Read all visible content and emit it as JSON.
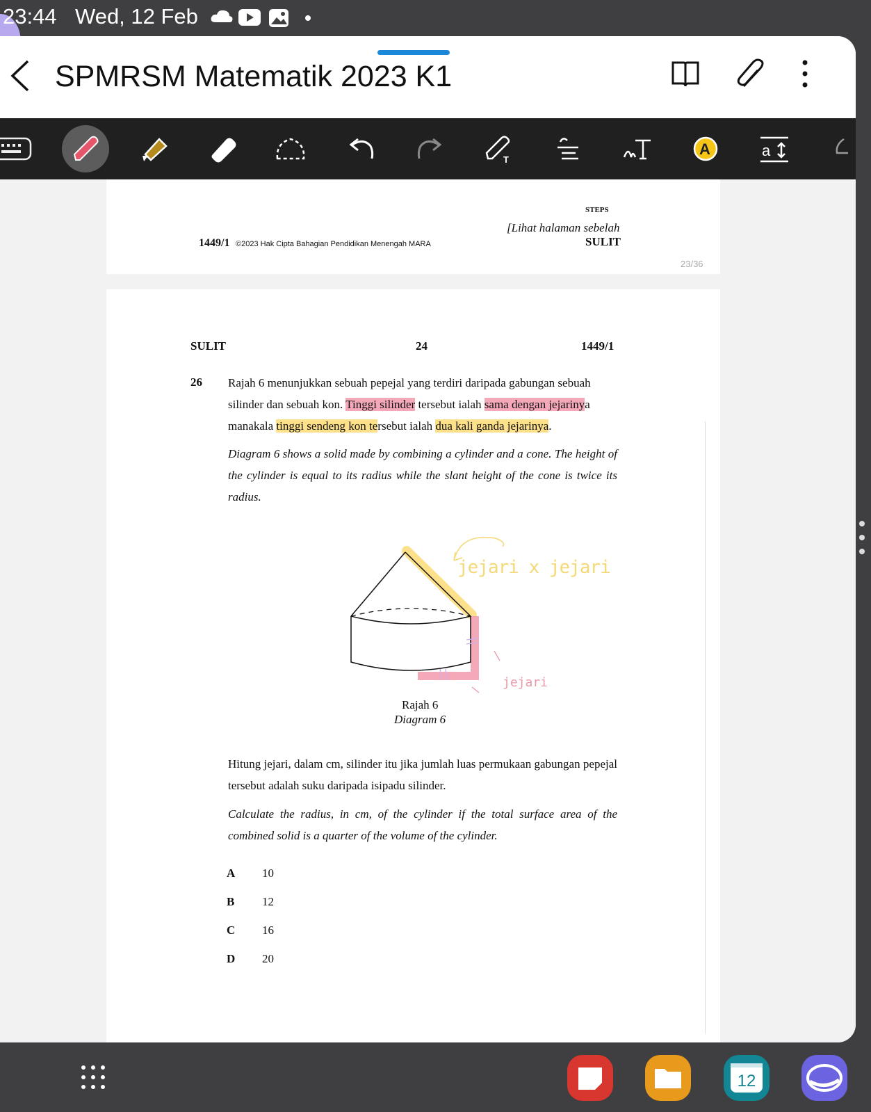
{
  "status_bar": {
    "time": "23:44",
    "date": "Wed, 12 Feb"
  },
  "header": {
    "title": "SPMRSM Matematik 2023 K1"
  },
  "toolbar": {
    "tools": [
      "keyboard",
      "pen",
      "highlighter",
      "eraser",
      "lasso",
      "undo",
      "redo",
      "pen-settings",
      "text",
      "handwriting-to-text",
      "text-box",
      "format",
      "more"
    ]
  },
  "page_indicator": "23/36",
  "prev_page": {
    "steps": "STEPS",
    "lihat": "[Lihat halaman sebelah",
    "code": "1449/1",
    "copyright": "©2023 Hak Cipta Bahagian Pendidikan Menengah MARA",
    "sulit": "SULIT"
  },
  "page": {
    "header_left": "SULIT",
    "header_center": "24",
    "header_right": "1449/1",
    "q_number": "26",
    "malay_1": "Rajah 6 menunjukkan sebuah pepejal yang terdiri daripada gabungan sebuah",
    "malay_2a": "silinder dan sebuah kon.",
    "malay_2b": "Tinggi silinder",
    "malay_2c": "tersebut ialah",
    "malay_2d": "sama dengan jejariny",
    "malay_2e": "a",
    "malay_3a": "manakala",
    "malay_3b": "tinggi sendeng kon te",
    "malay_3c": "rsebut ialah",
    "malay_3d": "dua kali ganda jejarinya",
    "malay_3e": ".",
    "english": "Diagram 6 shows a solid made by combining a cylinder and a cone. The height of the cylinder is equal to its radius while the slant height of the cone is twice its radius.",
    "diagram_label_malay": "Rajah 6",
    "diagram_label_english": "Diagram 6",
    "handwriting_1": "jejari x jejari",
    "handwriting_2": "jejari",
    "question_malay": "Hitung jejari, dalam cm, silinder itu jika jumlah luas permukaan gabungan pepejal tersebut adalah suku daripada isipadu silinder.",
    "question_english": "Calculate the radius, in cm, of the cylinder if the total surface area of the combined solid is a quarter of the volume of the cylinder.",
    "options": [
      {
        "letter": "A",
        "value": "10"
      },
      {
        "letter": "B",
        "value": "12"
      },
      {
        "letter": "C",
        "value": "16"
      },
      {
        "letter": "D",
        "value": "20"
      }
    ]
  },
  "dock": {
    "calendar_day": "12"
  },
  "colors": {
    "highlight_pink": "#f5a9b8",
    "highlight_yellow": "#fde08a",
    "pen_red": "#e5566a",
    "accent_blue": "#1e88d8"
  }
}
